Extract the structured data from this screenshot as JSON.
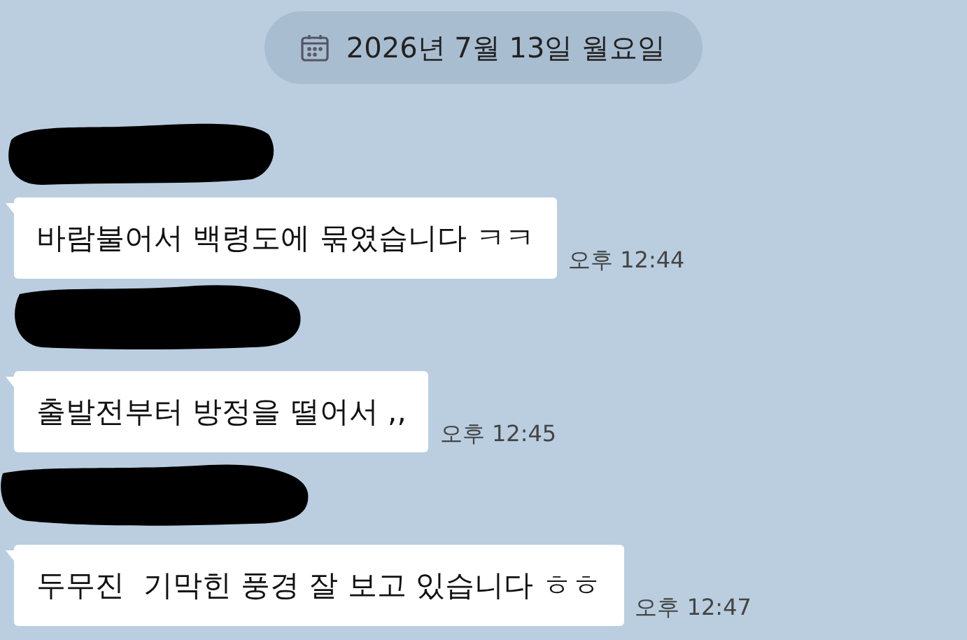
{
  "date_divider": {
    "text": "2026년 7월 13일 월요일"
  },
  "messages": [
    {
      "text": "바람불어서 백령도에 묶였습니다 ㅋㅋ",
      "time": "오후 12:44"
    },
    {
      "text": "출발전부터 방정을 떨어서 ,,",
      "time": "오후 12:45"
    },
    {
      "text": "두무진  기막힌 풍경 잘 보고 있습니다 ㅎㅎ",
      "time": "오후 12:47"
    }
  ]
}
